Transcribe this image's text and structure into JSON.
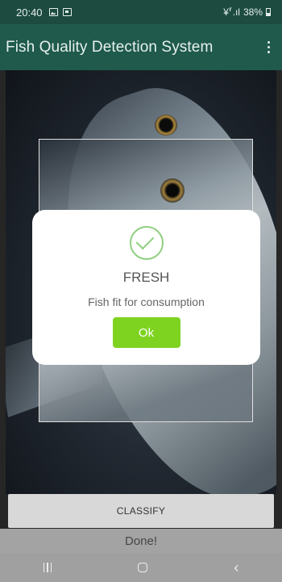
{
  "status_bar": {
    "time": "20:40",
    "signal_text": "¥⸢.ıl",
    "battery": "38%"
  },
  "app_bar": {
    "title": "Fish Quality Detection System"
  },
  "dialog": {
    "icon": "check-circle-icon",
    "title": "FRESH",
    "message": "Fish fit for consumption",
    "ok_label": "Ok"
  },
  "actions": {
    "classify_label": "CLASSIFY",
    "status_text": "Done!"
  },
  "colors": {
    "appbar": "#1f5a4c",
    "ok_button": "#7ed321",
    "check": "#8fd07f"
  }
}
